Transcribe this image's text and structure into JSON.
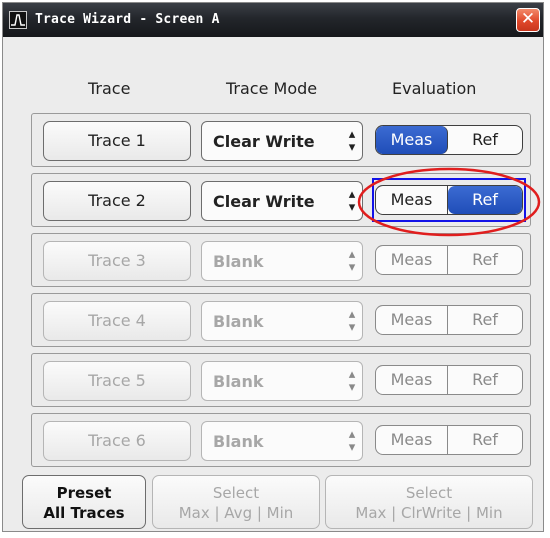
{
  "window": {
    "title": "Trace Wizard - Screen A",
    "app_icon": "spectrum-icon",
    "close_icon": "close-icon"
  },
  "headers": {
    "trace": "Trace",
    "mode": "Trace Mode",
    "evaluation": "Evaluation"
  },
  "traces": [
    {
      "label": "Trace 1",
      "mode": "Clear Write",
      "meas": "Meas",
      "ref": "Ref",
      "selected_eval": "Meas",
      "enabled": true
    },
    {
      "label": "Trace 2",
      "mode": "Clear Write",
      "meas": "Meas",
      "ref": "Ref",
      "selected_eval": "Ref",
      "enabled": true,
      "focused": true
    },
    {
      "label": "Trace 3",
      "mode": "Blank",
      "meas": "Meas",
      "ref": "Ref",
      "selected_eval": "",
      "enabled": false
    },
    {
      "label": "Trace 4",
      "mode": "Blank",
      "meas": "Meas",
      "ref": "Ref",
      "selected_eval": "",
      "enabled": false
    },
    {
      "label": "Trace 5",
      "mode": "Blank",
      "meas": "Meas",
      "ref": "Ref",
      "selected_eval": "",
      "enabled": false
    },
    {
      "label": "Trace 6",
      "mode": "Blank",
      "meas": "Meas",
      "ref": "Ref",
      "selected_eval": "",
      "enabled": false
    }
  ],
  "buttons": {
    "preset": {
      "line1": "Preset",
      "line2": "All Traces"
    },
    "select_avg": {
      "line1": "Select",
      "line2": "Max | Avg | Min"
    },
    "select_clrwrite": {
      "line1": "Select",
      "line2": "Max | ClrWrite | Min"
    }
  },
  "colors": {
    "accent": "#2a55c4",
    "highlight": "#e01e1e",
    "focus": "#1212e8"
  }
}
